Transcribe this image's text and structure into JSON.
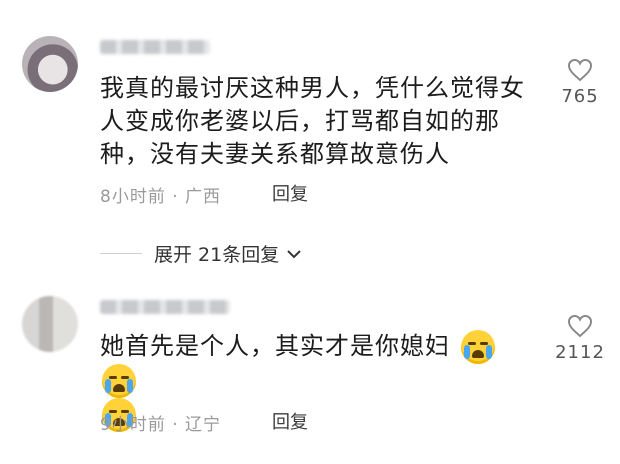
{
  "comments": [
    {
      "text": "我真的最讨厌这种男人，凭什么觉得女人变成你老婆以后，打骂都自如的那种，没有夫妻关系都算故意伤人",
      "line1": "我真的最讨厌这种男人，凭什么觉得女",
      "line2": "人变成你老婆以后，打骂都自如的那",
      "line3": "种，没有夫妻关系都算故意伤人",
      "time": "8小时前",
      "location": "广西",
      "reply_label": "回复",
      "like_count": "765",
      "icon": "heart-outline-icon"
    },
    {
      "text": "她首先是个人，其实才是你媳妇",
      "time": "9小时前",
      "location": "辽宁",
      "reply_label": "回复",
      "like_count": "2112",
      "icon": "heart-outline-icon",
      "emojis": [
        "crying-emoji",
        "crying-emoji",
        "crying-emoji"
      ]
    }
  ],
  "expand_replies": {
    "label": "展开 21条回复",
    "icon": "chevron-down-icon"
  }
}
